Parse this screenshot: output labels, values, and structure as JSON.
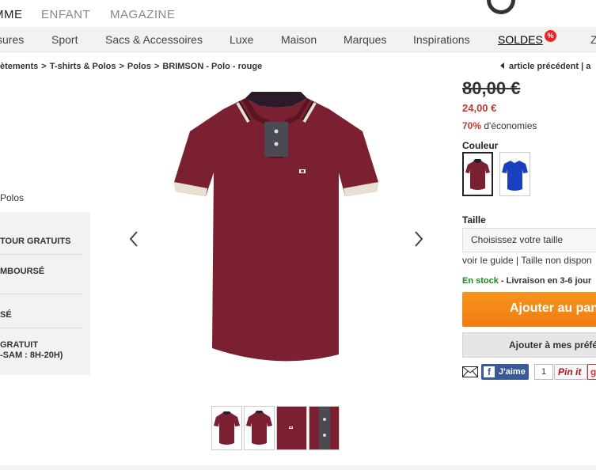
{
  "topnav": {
    "items": [
      "MME",
      "ENFANT",
      "MAGAZINE"
    ]
  },
  "catnav": {
    "items": [
      "sures",
      "Sport",
      "Sacs & Accessoires",
      "Luxe",
      "Maison",
      "Marques",
      "Inspirations",
      "SOLDES",
      "Z"
    ],
    "soldes_badge": "%"
  },
  "breadcrumb": {
    "items": [
      "ètements",
      "T-shirts & Polos",
      "Polos",
      "BRIMSON - Polo - rouge"
    ],
    "separator": ">"
  },
  "prev_link": "article précédent | a",
  "sidebar": {
    "category_label": "Polos",
    "service_items": [
      "TOUR GRATUITS",
      "MBOURSÉ",
      "SÉ",
      "GRATUIT",
      "-SAM : 8H-20H)"
    ]
  },
  "product": {
    "old_price": "80,00 €",
    "new_price": "24,00 €",
    "discount_pct": "70%",
    "discount_text": " d'économies",
    "color_label": "Couleur",
    "colors": [
      {
        "name": "rouge",
        "hex": "#7a2030",
        "selected": true
      },
      {
        "name": "bleu",
        "hex": "#1a3fbf",
        "selected": false
      }
    ],
    "size_label": "Taille",
    "size_placeholder": "Choisissez votre taille",
    "size_guide": "voir le guide | Taille non dispon",
    "stock": "En stock",
    "delivery": " - Livraison en 3-6 jour",
    "add_to_cart": "Ajouter au pan",
    "add_to_wishlist": "Ajouter à mes préfé",
    "fb_like": "J'aime",
    "fb_count": "1",
    "pinit": "Pin it",
    "gplus": "g"
  },
  "colors": {
    "accent_orange": "#f7941e",
    "price_red": "#c0392b",
    "stock_green": "#1a8a1a",
    "polo": "#7a2030"
  },
  "thumbnails": [
    {
      "name": "front"
    },
    {
      "name": "back"
    },
    {
      "name": "detail-logo"
    },
    {
      "name": "detail-collar"
    }
  ]
}
